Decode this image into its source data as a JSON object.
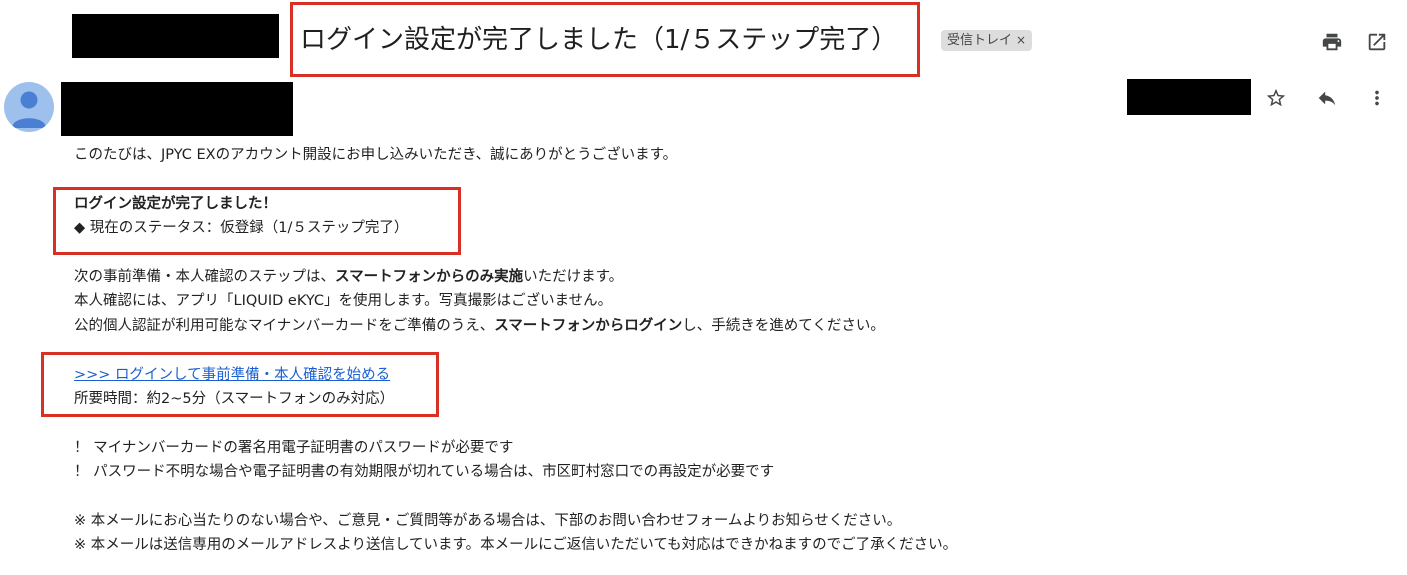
{
  "email": {
    "subject": "ログイン設定が完了しました（1/５ステップ完了）",
    "label": "受信トレイ",
    "label_remove": "×",
    "intro": "このたびは、JPYC EXのアカウント開設にお申し込みいただき、誠にありがとうございます。",
    "status": {
      "heading": "ログイン設定が完了しました！",
      "line": "◆ 現在のステータス：仮登録（1/５ステップ完了）"
    },
    "next_steps": {
      "l1_a": "次の事前準備・本人確認のステップは、",
      "l1_b": "スマートフォンからのみ実施",
      "l1_c": "いただけます。",
      "l2": "本人確認には、アプリ「LIQUID eKYC」を使用します。写真撮影はございません。",
      "l3_a": "公的個人認証が利用可能なマイナンバーカードをご準備のうえ、",
      "l3_b": "スマートフォンからログイン",
      "l3_c": "し、手続きを進めてください。"
    },
    "cta": {
      "link": ">>> ログインして事前準備・本人確認を始める",
      "time": "所要時間：約2~5分（スマートフォンのみ対応）"
    },
    "notes": [
      "！ マイナンバーカードの署名用電子証明書のパスワードが必要です",
      "！ パスワード不明な場合や電子証明書の有効期限が切れている場合は、市区町村窓口での再設定が必要です"
    ],
    "footer": [
      "※ 本メールにお心当たりのない場合や、ご意見・ご質問等がある場合は、下部のお問い合わせフォームよりお知らせください。",
      "※ 本メールは送信専用のメールアドレスより送信しています。本メールにご返信いただいても対応はできかねますのでご了承ください。"
    ]
  },
  "icons": {
    "print": "print-icon",
    "open_new": "open-in-new-icon",
    "star": "star-icon",
    "reply": "reply-icon",
    "more": "more-vert-icon",
    "avatar": "person-icon"
  },
  "colors": {
    "highlight_box": "#d93025",
    "link": "#1a5fd1",
    "avatar_bg": "#9dc0ed",
    "avatar_fg": "#4a7fd4"
  }
}
